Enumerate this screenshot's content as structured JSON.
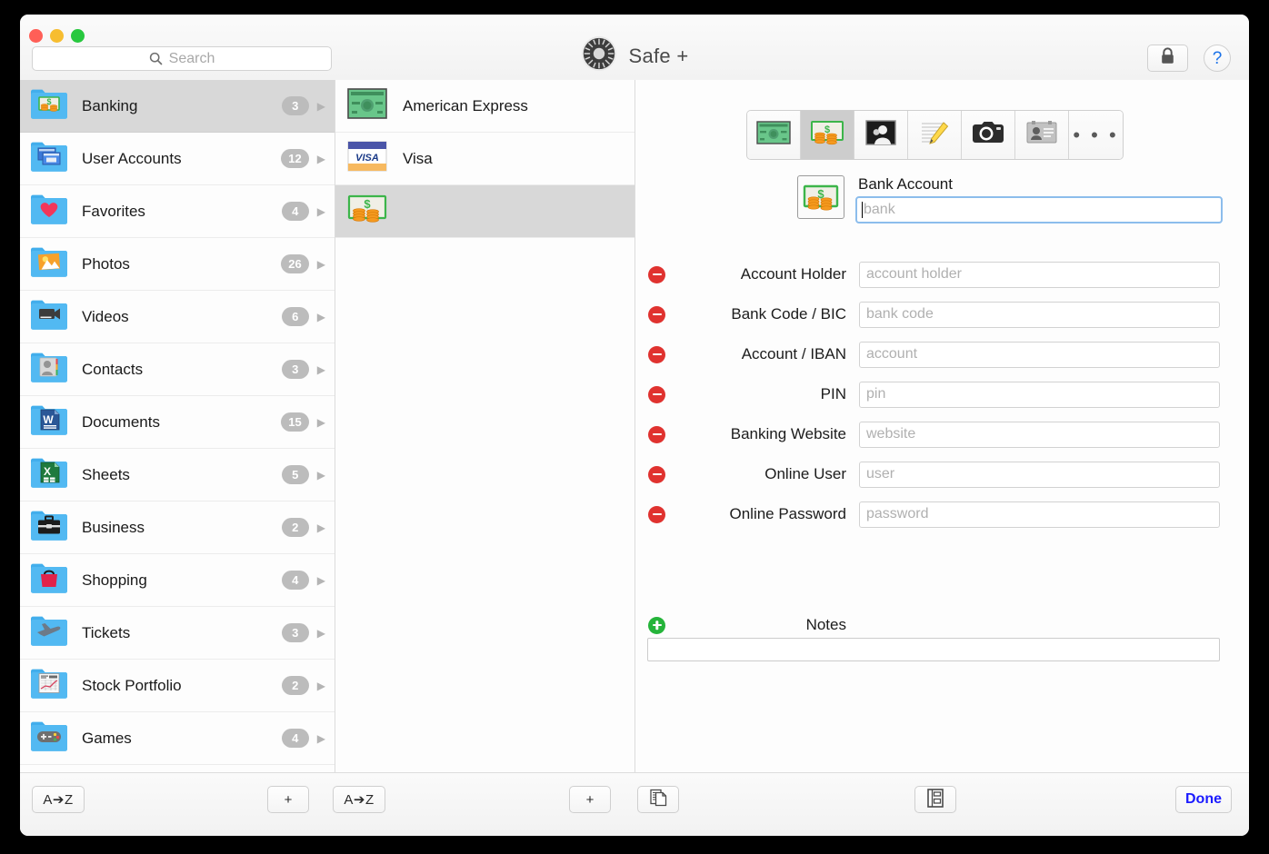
{
  "window": {
    "title": "Safe +",
    "traffic_lights": [
      "close",
      "minimize",
      "zoom"
    ],
    "accent_blue": "#1b1bff",
    "selection_gray": "#d8d8d8",
    "badge_gray": "#bcbcbc"
  },
  "titlebar": {
    "app_title": "Safe +",
    "app_icon": "vault-dial-icon",
    "lock_icon": "lock-icon",
    "help_label": "?"
  },
  "search": {
    "placeholder": "Search",
    "value": "",
    "icon": "search-icon"
  },
  "sidebar": {
    "items": [
      {
        "label": "Banking",
        "count": "3",
        "icon": "folder-banking-icon",
        "selected": true
      },
      {
        "label": "User Accounts",
        "count": "12",
        "icon": "folder-user-accounts-icon",
        "selected": false
      },
      {
        "label": "Favorites",
        "count": "4",
        "icon": "folder-favorites-icon",
        "selected": false
      },
      {
        "label": "Photos",
        "count": "26",
        "icon": "folder-photos-icon",
        "selected": false
      },
      {
        "label": "Videos",
        "count": "6",
        "icon": "folder-videos-icon",
        "selected": false
      },
      {
        "label": "Contacts",
        "count": "3",
        "icon": "folder-contacts-icon",
        "selected": false
      },
      {
        "label": "Documents",
        "count": "15",
        "icon": "folder-documents-icon",
        "selected": false
      },
      {
        "label": "Sheets",
        "count": "5",
        "icon": "folder-sheets-icon",
        "selected": false
      },
      {
        "label": "Business",
        "count": "2",
        "icon": "folder-business-icon",
        "selected": false
      },
      {
        "label": "Shopping",
        "count": "4",
        "icon": "folder-shopping-icon",
        "selected": false
      },
      {
        "label": "Tickets",
        "count": "3",
        "icon": "folder-tickets-icon",
        "selected": false
      },
      {
        "label": "Stock Portfolio",
        "count": "2",
        "icon": "folder-stock-icon",
        "selected": false
      },
      {
        "label": "Games",
        "count": "4",
        "icon": "folder-games-icon",
        "selected": false
      }
    ]
  },
  "list": {
    "items": [
      {
        "label": "American Express",
        "icon": "credit-card-amex-icon",
        "selected": false
      },
      {
        "label": "Visa",
        "icon": "credit-card-visa-icon",
        "selected": false
      },
      {
        "label": "",
        "icon": "bank-note-icon",
        "selected": true
      }
    ]
  },
  "detail": {
    "type_toolbar": [
      {
        "icon": "credit-card-icon",
        "active": false
      },
      {
        "icon": "bank-note-icon",
        "active": true
      },
      {
        "icon": "portrait-icon",
        "active": false
      },
      {
        "icon": "note-pencil-icon",
        "active": false
      },
      {
        "icon": "camera-icon",
        "active": false
      },
      {
        "icon": "contact-card-icon",
        "active": false
      },
      {
        "icon": "more-dots-icon",
        "active": false,
        "label": "• • •"
      }
    ],
    "entry": {
      "icon": "bank-note-icon",
      "title": "Bank Account",
      "name_value": "",
      "name_placeholder": "bank"
    },
    "fields": [
      {
        "label": "Account Holder",
        "value": "",
        "placeholder": "account holder",
        "action": "remove"
      },
      {
        "label": "Bank Code / BIC",
        "value": "",
        "placeholder": "bank code",
        "action": "remove"
      },
      {
        "label": "Account / IBAN",
        "value": "",
        "placeholder": "account",
        "action": "remove"
      },
      {
        "label": "PIN",
        "value": "",
        "placeholder": "pin",
        "action": "remove"
      },
      {
        "label": "Banking Website",
        "value": "",
        "placeholder": "website",
        "action": "remove"
      },
      {
        "label": "Online User",
        "value": "",
        "placeholder": "user",
        "action": "remove"
      },
      {
        "label": "Online Password",
        "value": "",
        "placeholder": "password",
        "action": "remove"
      }
    ],
    "notes": {
      "label": "Notes",
      "value": "",
      "action": "add"
    }
  },
  "bottombar": {
    "sort_sidebar_label": "A➔Z",
    "add_category_label": "+",
    "sort_list_label": "A➔Z",
    "add_entry_label": "+",
    "duplicate_icon": "duplicate-icon",
    "template_icon": "template-icon",
    "done_label": "Done"
  }
}
